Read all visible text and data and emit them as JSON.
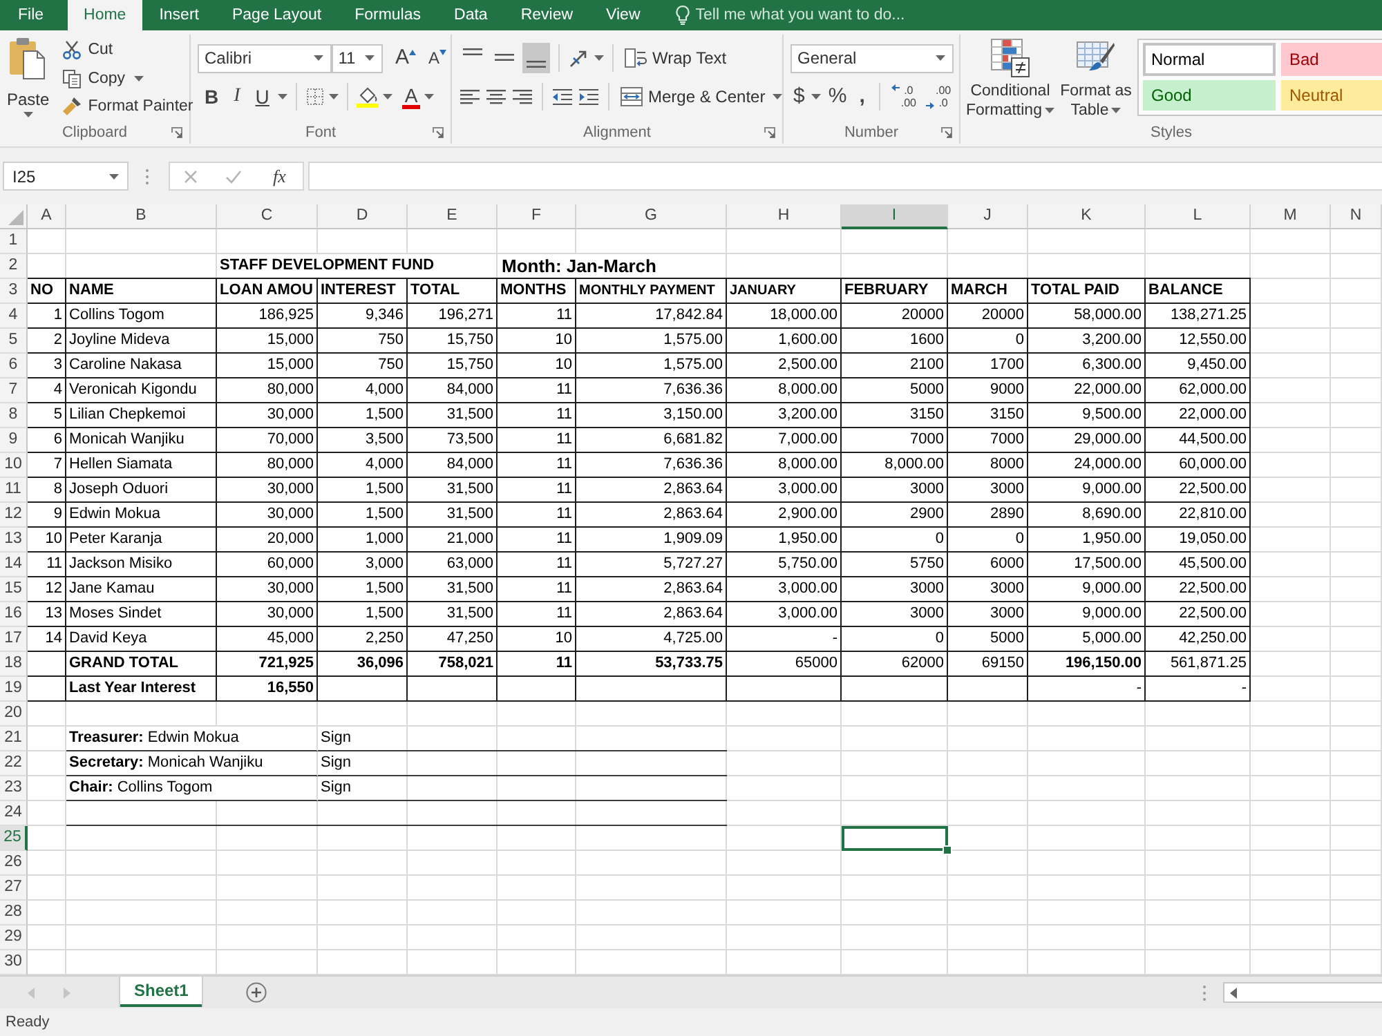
{
  "menu_tabs": [
    {
      "label": "File",
      "selected": false
    },
    {
      "label": "Home",
      "selected": true
    },
    {
      "label": "Insert",
      "selected": false
    },
    {
      "label": "Page Layout",
      "selected": false
    },
    {
      "label": "Formulas",
      "selected": false
    },
    {
      "label": "Data",
      "selected": false
    },
    {
      "label": "Review",
      "selected": false
    },
    {
      "label": "View",
      "selected": false
    }
  ],
  "tell_me": {
    "placeholder": "Tell me what you want to do..."
  },
  "ribbon": {
    "clipboard": {
      "label": "Clipboard",
      "paste": "Paste",
      "cut": "Cut",
      "copy": "Copy",
      "format_painter": "Format Painter"
    },
    "font": {
      "label": "Font",
      "name": "Calibri",
      "size": "11",
      "grow": "A",
      "shrink": "A",
      "bold": "B",
      "italic": "I",
      "underline": "U",
      "font_color": "A"
    },
    "alignment": {
      "label": "Alignment",
      "vertical": [
        {
          "selected": false
        },
        {
          "selected": false
        },
        {
          "selected": true
        }
      ],
      "wrap_text": "Wrap Text",
      "merge_center": "Merge & Center"
    },
    "number": {
      "label": "Number",
      "format": "General",
      "currency": "$",
      "percent": "%",
      "comma": ",",
      "decimals": [
        {
          "top": ".0",
          "bottom": ".00"
        },
        {
          "top": ".00",
          "bottom": ".0"
        }
      ]
    },
    "styles": {
      "label": "Styles",
      "conditional_formatting": "Conditional Formatting",
      "format_as_table": "Format as Table",
      "gallery": [
        {
          "label": "Normal",
          "kind": "normal",
          "selected": true
        },
        {
          "label": "Bad",
          "kind": "bad",
          "selected": false
        },
        {
          "label": "Good",
          "kind": "good",
          "selected": false
        },
        {
          "label": "Neutral",
          "kind": "neutral",
          "selected": false
        }
      ]
    }
  },
  "formula_bar": {
    "name_box": "I25",
    "function_button": "fx"
  },
  "sheet": {
    "columns": [
      {
        "label": "A",
        "selected": false
      },
      {
        "label": "B",
        "selected": false
      },
      {
        "label": "C",
        "selected": false
      },
      {
        "label": "D",
        "selected": false
      },
      {
        "label": "E",
        "selected": false
      },
      {
        "label": "F",
        "selected": false
      },
      {
        "label": "G",
        "selected": false
      },
      {
        "label": "H",
        "selected": false
      },
      {
        "label": "I",
        "selected": true
      },
      {
        "label": "J",
        "selected": false
      },
      {
        "label": "K",
        "selected": false
      },
      {
        "label": "L",
        "selected": false
      },
      {
        "label": "M",
        "selected": false
      },
      {
        "label": "N",
        "selected": false
      }
    ],
    "rows": [
      {
        "label": "1",
        "selected": false
      },
      {
        "label": "2",
        "selected": false
      },
      {
        "label": "3",
        "selected": false
      },
      {
        "label": "4",
        "selected": false
      },
      {
        "label": "5",
        "selected": false
      },
      {
        "label": "6",
        "selected": false
      },
      {
        "label": "7",
        "selected": false
      },
      {
        "label": "8",
        "selected": false
      },
      {
        "label": "9",
        "selected": false
      },
      {
        "label": "10",
        "selected": false
      },
      {
        "label": "11",
        "selected": false
      },
      {
        "label": "12",
        "selected": false
      },
      {
        "label": "13",
        "selected": false
      },
      {
        "label": "14",
        "selected": false
      },
      {
        "label": "15",
        "selected": false
      },
      {
        "label": "16",
        "selected": false
      },
      {
        "label": "17",
        "selected": false
      },
      {
        "label": "18",
        "selected": false
      },
      {
        "label": "19",
        "selected": false
      },
      {
        "label": "20",
        "selected": false
      },
      {
        "label": "21",
        "selected": false
      },
      {
        "label": "22",
        "selected": false
      },
      {
        "label": "23",
        "selected": false
      },
      {
        "label": "24",
        "selected": false
      },
      {
        "label": "25",
        "selected": true
      },
      {
        "label": "26",
        "selected": false
      },
      {
        "label": "27",
        "selected": false
      },
      {
        "label": "28",
        "selected": false
      },
      {
        "label": "29",
        "selected": false
      },
      {
        "label": "30",
        "selected": false
      }
    ],
    "title": "STAFF DEVELOPMENT FUND",
    "period": "Month: Jan-March",
    "table": {
      "columns": [
        "NO",
        "NAME",
        "LOAN AMOU",
        "INTEREST",
        "TOTAL",
        "MONTHS",
        "MONTHLY PAYMENT",
        "JANUARY",
        "FEBRUARY",
        "MARCH",
        "TOTAL PAID",
        "BALANCE"
      ],
      "rows": [
        {
          "kind": "data",
          "cells": [
            "1",
            "Collins Togom",
            "186,925",
            "9,346",
            "196,271",
            "11",
            "17,842.84",
            "18,000.00",
            "20000",
            "20000",
            "58,000.00",
            "138,271.25"
          ]
        },
        {
          "kind": "data",
          "cells": [
            "2",
            "Joyline Mideva",
            "15,000",
            "750",
            "15,750",
            "10",
            "1,575.00",
            "1,600.00",
            "1600",
            "0",
            "3,200.00",
            "12,550.00"
          ]
        },
        {
          "kind": "data",
          "cells": [
            "3",
            "Caroline Nakasa",
            "15,000",
            "750",
            "15,750",
            "10",
            "1,575.00",
            "2,500.00",
            "2100",
            "1700",
            "6,300.00",
            "9,450.00"
          ]
        },
        {
          "kind": "data",
          "cells": [
            "4",
            "Veronicah Kigondu",
            "80,000",
            "4,000",
            "84,000",
            "11",
            "7,636.36",
            "8,000.00",
            "5000",
            "9000",
            "22,000.00",
            "62,000.00"
          ]
        },
        {
          "kind": "data",
          "cells": [
            "5",
            "Lilian Chepkemoi",
            "30,000",
            "1,500",
            "31,500",
            "11",
            "3,150.00",
            "3,200.00",
            "3150",
            "3150",
            "9,500.00",
            "22,000.00"
          ]
        },
        {
          "kind": "data",
          "cells": [
            "6",
            "Monicah Wanjiku",
            "70,000",
            "3,500",
            "73,500",
            "11",
            "6,681.82",
            "7,000.00",
            "7000",
            "7000",
            "29,000.00",
            "44,500.00"
          ]
        },
        {
          "kind": "data",
          "cells": [
            "7",
            "Hellen Siamata",
            "80,000",
            "4,000",
            "84,000",
            "11",
            "7,636.36",
            "8,000.00",
            "8,000.00",
            "8000",
            "24,000.00",
            "60,000.00"
          ]
        },
        {
          "kind": "data",
          "cells": [
            "8",
            "Joseph Oduori",
            "30,000",
            "1,500",
            "31,500",
            "11",
            "2,863.64",
            "3,000.00",
            "3000",
            "3000",
            "9,000.00",
            "22,500.00"
          ]
        },
        {
          "kind": "data",
          "cells": [
            "9",
            "Edwin Mokua",
            "30,000",
            "1,500",
            "31,500",
            "11",
            "2,863.64",
            "2,900.00",
            "2900",
            "2890",
            "8,690.00",
            "22,810.00"
          ]
        },
        {
          "kind": "data",
          "cells": [
            "10",
            "Peter Karanja",
            "20,000",
            "1,000",
            "21,000",
            "11",
            "1,909.09",
            "1,950.00",
            "0",
            "0",
            "1,950.00",
            "19,050.00"
          ]
        },
        {
          "kind": "data",
          "cells": [
            "11",
            "Jackson Misiko",
            "60,000",
            "3,000",
            "63,000",
            "11",
            "5,727.27",
            "5,750.00",
            "5750",
            "6000",
            "17,500.00",
            "45,500.00"
          ]
        },
        {
          "kind": "data",
          "cells": [
            "12",
            "Jane Kamau",
            "30,000",
            "1,500",
            "31,500",
            "11",
            "2,863.64",
            "3,000.00",
            "3000",
            "3000",
            "9,000.00",
            "22,500.00"
          ]
        },
        {
          "kind": "data",
          "cells": [
            "13",
            "Moses Sindet",
            "30,000",
            "1,500",
            "31,500",
            "11",
            "2,863.64",
            "3,000.00",
            "3000",
            "3000",
            "9,000.00",
            "22,500.00"
          ]
        },
        {
          "kind": "data",
          "cells": [
            "14",
            "David Keya",
            "45,000",
            "2,250",
            "47,250",
            "10",
            "4,725.00",
            "-",
            "0",
            "5000",
            "5,000.00",
            "42,250.00"
          ]
        },
        {
          "kind": "total",
          "cells": [
            null,
            {
              "text": "GRAND TOTAL",
              "bold": true
            },
            {
              "text": "721,925",
              "bold": true
            },
            {
              "text": "36,096",
              "bold": true
            },
            {
              "text": "758,021",
              "bold": true
            },
            {
              "text": "11",
              "bold": true
            },
            {
              "text": "53,733.75",
              "bold": true
            },
            {
              "text": "65000",
              "bold": false
            },
            {
              "text": "62000",
              "bold": false
            },
            {
              "text": "69150",
              "bold": false
            },
            {
              "text": "196,150.00",
              "bold": true
            },
            {
              "text": "561,871.25",
              "bold": false
            }
          ]
        },
        {
          "kind": "total",
          "cells": [
            null,
            {
              "text": "Last Year Interest",
              "bold": true
            },
            {
              "text": "16,550",
              "bold": true
            },
            null,
            null,
            null,
            null,
            null,
            null,
            null,
            {
              "text": "-",
              "bold": false
            },
            {
              "text": "-",
              "bold": false
            }
          ]
        }
      ]
    },
    "signatures": [
      {
        "text": "**Treasurer:** Edwin Mokua",
        "sign": "Sign"
      },
      {
        "text": "**Secretary:** Monicah Wanjiku",
        "sign": "Sign"
      },
      {
        "text": "**Chair:** Collins Togom",
        "sign": "Sign"
      }
    ]
  },
  "sheet_tabs": [
    {
      "label": "Sheet1",
      "selected": true
    }
  ],
  "status_bar": {
    "text": "Ready"
  }
}
